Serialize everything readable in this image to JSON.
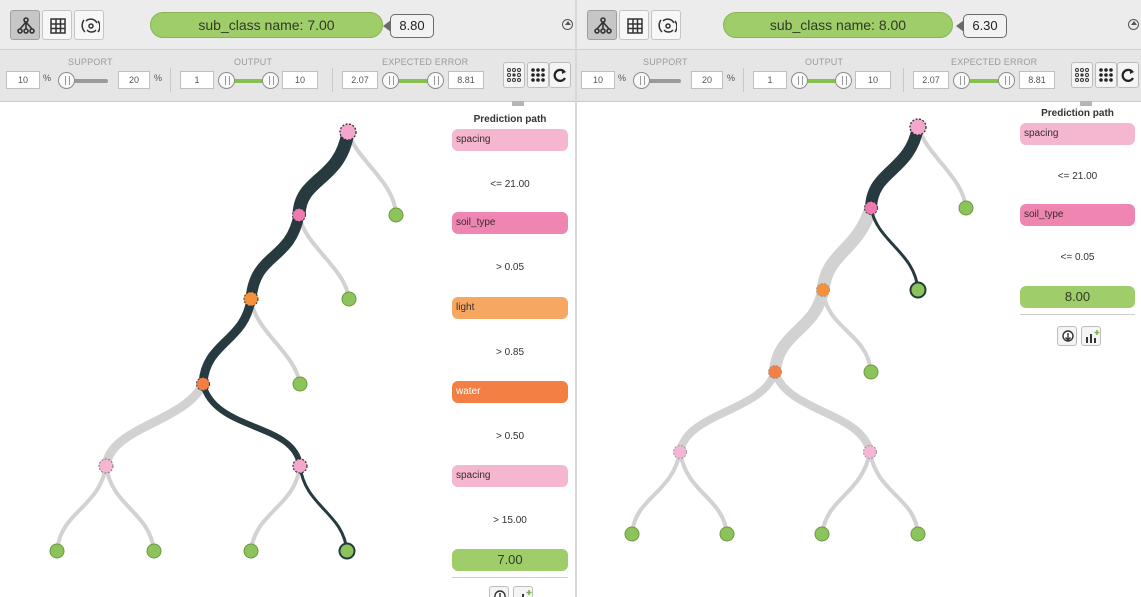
{
  "panels": [
    {
      "id": "left",
      "header": {
        "class_label": "sub_class name: 7.00",
        "value": "8.80"
      },
      "filters": {
        "support": {
          "label": "SUPPORT",
          "min": "10",
          "max": "20",
          "unit": "%"
        },
        "output": {
          "label": "OUTPUT",
          "min": "1",
          "max": "10"
        },
        "expected_error": {
          "label": "EXPECTED ERROR",
          "min": "2.07",
          "max": "8.81"
        }
      },
      "prediction_path": {
        "title": "Prediction path",
        "steps": [
          {
            "field": "spacing",
            "condition": "<= 21.00"
          },
          {
            "field": "soil_type",
            "condition": "> 0.05"
          },
          {
            "field": "light",
            "condition": "> 0.85"
          },
          {
            "field": "water",
            "condition": "> 0.50"
          },
          {
            "field": "spacing",
            "condition": "> 15.00"
          }
        ],
        "result": "7.00"
      }
    },
    {
      "id": "right",
      "header": {
        "class_label": "sub_class name: 8.00",
        "value": "6.30"
      },
      "filters": {
        "support": {
          "label": "SUPPORT",
          "min": "10",
          "max": "20",
          "unit": "%"
        },
        "output": {
          "label": "OUTPUT",
          "min": "1",
          "max": "10"
        },
        "expected_error": {
          "label": "EXPECTED ERROR",
          "min": "2.07",
          "max": "8.81"
        }
      },
      "prediction_path": {
        "title": "Prediction path",
        "steps": [
          {
            "field": "spacing",
            "condition": "<= 21.00"
          },
          {
            "field": "soil_type",
            "condition": "<= 0.05"
          }
        ],
        "result": "8.00"
      }
    }
  ],
  "colors": {
    "leaf": "#8cc35a",
    "pink_node": "#f4a7cc",
    "orange_node": "#f5913a",
    "highlight_path": "#263a40",
    "inactive_branch": "#d2d2d2"
  },
  "icons": [
    "tree-view-icon",
    "grid-view-icon",
    "sunburst-view-icon",
    "collapse-icon",
    "dots-expand-icon",
    "dots-grid-icon",
    "refresh-icon",
    "tree-download-icon",
    "chart-add-icon"
  ]
}
